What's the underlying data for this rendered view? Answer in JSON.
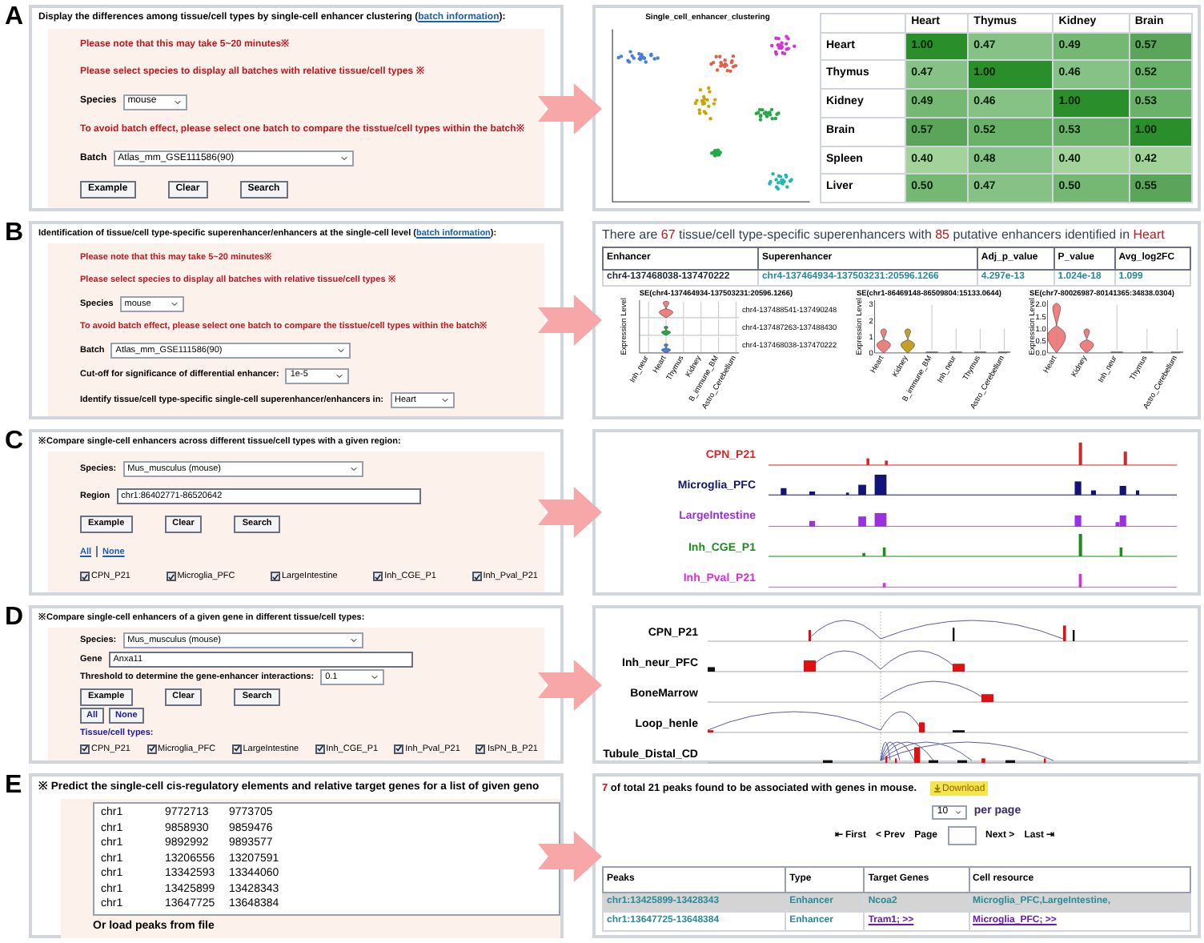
{
  "panels": [
    {
      "letter": "A",
      "kind": "clustering",
      "form": {
        "title": "Display the differences among tissue/cell types by single-cell enhancer clustering (",
        "title_link": "batch information",
        "title_end": "):",
        "rows": [
          {
            "kind": "note",
            "text": "Please note that this may take 5~20 minutes※"
          },
          {
            "kind": "note",
            "text": "Please select species to display all batches with relative tissue/cell types ※"
          },
          {
            "kind": "select",
            "label": "Species",
            "value": "mouse"
          },
          {
            "kind": "note",
            "text": "To avoid batch effect, please select one batch to compare the tisstue/cell types within the batch※"
          },
          {
            "kind": "select",
            "label": "Batch",
            "value": "Atlas_mm_GSE111586(90)"
          },
          {
            "kind": "buttons",
            "items": [
              "Example",
              "Clear",
              "Search"
            ]
          }
        ]
      },
      "result": {
        "plot_title": "Single_cell_enhancer_clustering",
        "columns": [
          "Heart",
          "Thymus",
          "Kidney",
          "Brain"
        ],
        "rows": [
          {
            "name": "Heart",
            "cells": [
              {
                "text": "1.00",
                "color": "#2a8f2a"
              },
              {
                "text": "0.47",
                "color": "#86c286"
              },
              {
                "text": "0.49",
                "color": "#74b874"
              },
              {
                "text": "0.57",
                "color": "#5aa55a"
              }
            ]
          },
          {
            "name": "Thymus",
            "cells": [
              {
                "text": "0.47",
                "color": "#86c286"
              },
              {
                "text": "1.00",
                "color": "#2a8f2a"
              },
              {
                "text": "0.46",
                "color": "#86c286"
              },
              {
                "text": "0.52",
                "color": "#6ab26a"
              }
            ]
          },
          {
            "name": "Kidney",
            "cells": [
              {
                "text": "0.49",
                "color": "#74b874"
              },
              {
                "text": "0.46",
                "color": "#86c286"
              },
              {
                "text": "1.00",
                "color": "#2a8f2a"
              },
              {
                "text": "0.53",
                "color": "#6ab26a"
              }
            ]
          },
          {
            "name": "Brain",
            "cells": [
              {
                "text": "0.57",
                "color": "#5aa55a"
              },
              {
                "text": "0.52",
                "color": "#6ab26a"
              },
              {
                "text": "0.53",
                "color": "#6ab26a"
              },
              {
                "text": "1.00",
                "color": "#2a8f2a"
              }
            ]
          },
          {
            "name": "Spleen",
            "cells": [
              {
                "text": "0.40",
                "color": "#a3d39a"
              },
              {
                "text": "0.48",
                "color": "#86c286"
              },
              {
                "text": "0.40",
                "color": "#a3d39a"
              },
              {
                "text": "0.42",
                "color": "#a3d39a"
              }
            ]
          },
          {
            "name": "Liver",
            "cells": [
              {
                "text": "0.50",
                "color": "#74b874"
              },
              {
                "text": "0.47",
                "color": "#86c286"
              },
              {
                "text": "0.50",
                "color": "#74b874"
              },
              {
                "text": "0.55",
                "color": "#5aa55a"
              }
            ]
          }
        ]
      }
    },
    {
      "letter": "B",
      "kind": "superenhancer",
      "form": {
        "title": "Identification of tissue/cell type-specific superenhancer/enhancers at the single-cell level (",
        "title_link": "batch information",
        "title_end": "):",
        "rows": [
          {
            "kind": "note",
            "text": "Please note that this may take 5~20 minutes※"
          },
          {
            "kind": "note",
            "text": "Please select species to display all batches with relative tissue/cell types ※"
          },
          {
            "kind": "select",
            "label": "Species",
            "value": "mouse"
          },
          {
            "kind": "note",
            "text": "To avoid batch effect, please select one batch to compare the tisstue/cell types within the batch※"
          },
          {
            "kind": "select",
            "label": "Batch",
            "value": "Atlas_mm_GSE111586(90)"
          },
          {
            "kind": "select",
            "label": "Cut-off for significance of differential enhancer:",
            "value": "1e-5"
          },
          {
            "kind": "select",
            "label": "Identify tissue/cell type-specific single-cell superenhancer/enhancers in:",
            "value": "Heart"
          }
        ]
      },
      "result": {
        "heading": [
          {
            "text": "There are ",
            "highlight": false
          },
          {
            "text": "67",
            "highlight": true
          },
          {
            "text": " tissue/cell type-specific superenhancers with ",
            "highlight": false
          },
          {
            "text": "85",
            "highlight": true
          },
          {
            "text": " putative enhancers identified in ",
            "highlight": false
          },
          {
            "text": "Heart",
            "highlight": true
          }
        ],
        "columns": [
          "Enhancer",
          "Superenhancer",
          "Adj_p_value",
          "P_value",
          "Avg_log2FC"
        ],
        "row": [
          "chr4-137468038-137470222",
          "chr4-137464934-137503231:20596.1266",
          "4.297e-13",
          "1.024e-18",
          "1.099"
        ],
        "plots": [
          {
            "kind": "stacked",
            "title": "SE(chr4-137464934-137503231:20596.1266)",
            "ylabel": "Expression Level",
            "rows": [
              "chr4-137488541-137490248",
              "chr4-137487263-137488430",
              "chr4-137468038-137470222"
            ],
            "categories": [
              "Inh_neur",
              "Heart",
              "Thymus",
              "Kidney",
              "B_immune_BM",
              "Astro_Cerebellum"
            ]
          },
          {
            "kind": "single",
            "title": "SE(chr1-86469148-86509804:15133.0644)",
            "ylabel": "Expression Level",
            "yticks": [
              "3",
              "2",
              "1",
              "0"
            ],
            "categories": [
              "Heart",
              "Kidney",
              "B_immune_BM",
              "Inh_neur",
              "Thymus",
              "Astro_Cerebellum"
            ]
          },
          {
            "kind": "single",
            "title": "SE(chr7-80026987-80141365:34838.0304)",
            "ylabel": "Expression Level",
            "yticks": [
              "2.0",
              "1.5",
              "1.0",
              "0.5",
              "0.0"
            ],
            "categories": [
              "Heart",
              "Kidney",
              "Inh_neur",
              "Thymus",
              "Astro_Cerebellum"
            ]
          }
        ]
      }
    },
    {
      "letter": "C",
      "kind": "region",
      "form": {
        "title": "※Compare single-cell enhancers across different tissue/cell types with a given region:",
        "rows": [
          {
            "kind": "select",
            "label": "Species:",
            "value": "Mus_musculus (mouse)"
          },
          {
            "kind": "input",
            "label": "Region",
            "value": "chr1:86402771-86520642"
          },
          {
            "kind": "buttons",
            "items": [
              "Example",
              "Clear",
              "Search"
            ]
          },
          {
            "kind": "links",
            "items": [
              "All",
              "None"
            ]
          },
          {
            "kind": "checks",
            "items": [
              {
                "label": "CPN_P21",
                "checked": true
              },
              {
                "label": "Microglia_PFC",
                "checked": true
              },
              {
                "label": "LargeIntestine",
                "checked": true
              },
              {
                "label": "Inh_CGE_P1",
                "checked": true
              },
              {
                "label": "Inh_Pval_P21",
                "checked": true
              }
            ]
          }
        ]
      },
      "result": {
        "tracks": [
          {
            "name": "CPN_P21",
            "color": "#d62728"
          },
          {
            "name": "Microglia_PFC",
            "color": "#13137a"
          },
          {
            "name": "LargeIntestine",
            "color": "#9b30e0"
          },
          {
            "name": "Inh_CGE_P1",
            "color": "#1e8c1e"
          },
          {
            "name": "Inh_Pval_P21",
            "color": "#d630d6"
          }
        ]
      }
    },
    {
      "letter": "D",
      "kind": "gene",
      "form": {
        "title": "※Compare single-cell enhancers of a given gene in different tissue/cell types:",
        "rows": [
          {
            "kind": "select",
            "label": "Species:",
            "value": "Mus_musculus (mouse)"
          },
          {
            "kind": "input",
            "label": "Gene",
            "value": "Anxa11"
          },
          {
            "kind": "select",
            "label": "Threshold to determine the gene-enhancer interactions:",
            "value": "0.1"
          },
          {
            "kind": "buttons",
            "items": [
              "Example",
              "Clear",
              "Search"
            ]
          },
          {
            "kind": "toggles",
            "items": [
              "All",
              "None"
            ]
          },
          {
            "kind": "subhead",
            "text": "Tissue/cell types:"
          },
          {
            "kind": "checks",
            "items": [
              {
                "label": "CPN_P21",
                "checked": true
              },
              {
                "label": "Microglia_PFC",
                "checked": true
              },
              {
                "label": "LargeIntestine",
                "checked": true
              },
              {
                "label": "Inh_CGE_P1",
                "checked": true
              },
              {
                "label": "Inh_Pval_P21",
                "checked": true
              },
              {
                "label": "IsPN_B_P21",
                "checked": true
              }
            ]
          }
        ]
      },
      "result": {
        "tracks": [
          {
            "name": "CPN_P21"
          },
          {
            "name": "Inh_neur_PFC"
          },
          {
            "name": "BoneMarrow"
          },
          {
            "name": "Loop_henle"
          },
          {
            "name": "Tubule_Distal_CD"
          }
        ]
      }
    },
    {
      "letter": "E",
      "kind": "predict",
      "form": {
        "title": "※ Predict the single-cell cis-regulatory elements and relative target genes for a list of given geno",
        "rows": [
          {
            "kind": "textarea",
            "lines": [
              "chr1\t9772713\t9773705",
              "chr1\t9858930\t9859476",
              "chr1\t9892992\t9893577",
              "chr1\t13206556\t13207591",
              "chr1\t13342593\t13344060",
              "chr1\t13425899\t13428343",
              "chr1\t13647725\t13648384"
            ]
          },
          {
            "kind": "plain",
            "text": "Or load peaks from file"
          }
        ]
      },
      "result": {
        "count": "7",
        "summary": " of total 21 peaks found to be associated with genes in mouse.",
        "download": "Download",
        "per_page_value": "10",
        "per_page_label": "per page",
        "first": "⇤ First",
        "prev": "< Prev",
        "page_label": "Page",
        "next": "Next >",
        "last": "Last ⇥",
        "columns": [
          "Peaks",
          "Type",
          "Target Genes",
          "Cell resource"
        ],
        "rows": [
          {
            "selected": true,
            "cells": [
              {
                "text": "chr1:13425899-13428343",
                "link": false
              },
              {
                "text": "Enhancer",
                "link": false
              },
              {
                "text": "Ncoa2",
                "link": false
              },
              {
                "text": "Microglia_PFC,LargeIntestine,",
                "link": false
              }
            ]
          },
          {
            "selected": false,
            "cells": [
              {
                "text": "chr1:13647725-13648384",
                "link": false
              },
              {
                "text": "Enhancer",
                "link": false
              },
              {
                "text": "Tram1; >>",
                "link": true
              },
              {
                "text": "Microglia_PFC; >>",
                "link": true
              }
            ]
          }
        ]
      }
    }
  ]
}
